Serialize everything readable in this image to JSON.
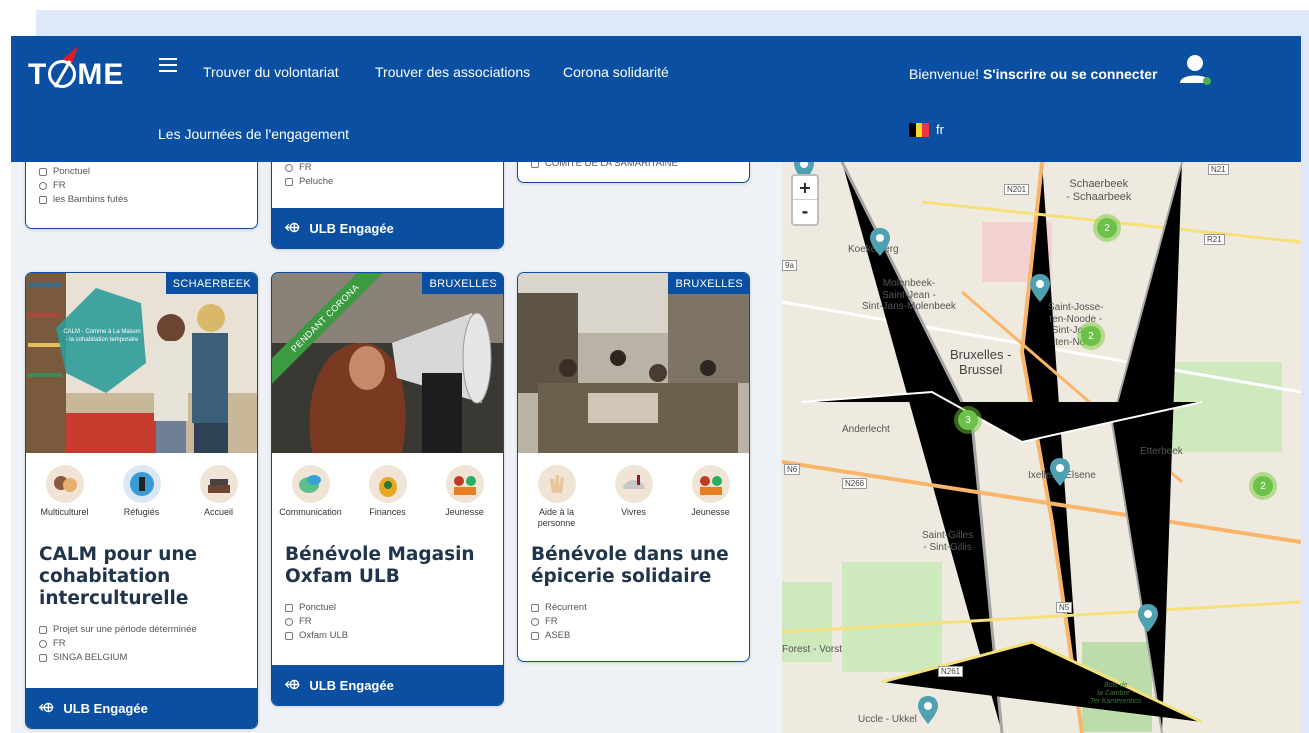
{
  "header": {
    "logo_text": "TIME",
    "nav": [
      "Trouver du volontariat",
      "Trouver des associations",
      "Corona solidarité"
    ],
    "nav_second_row": "Les Journées de l'engagement",
    "welcome": "Bienvenue!",
    "login": "S'inscrire ou se connecter",
    "lang": "fr"
  },
  "top_cards": [
    {
      "meta": [
        "Ponctuel",
        "FR",
        "les Bambins futés"
      ]
    },
    {
      "meta": [
        "FR",
        "Peluche"
      ],
      "footer": "ULB Engagée"
    },
    {
      "meta": [
        "COMITE DE LA SAMARITAINE"
      ]
    }
  ],
  "cards": [
    {
      "place": "SCHAERBEEK",
      "image_caption": "CALM - Comme à La Maison - la cohabitation temporaire",
      "tags": [
        "Multiculturel",
        "Réfugiés",
        "Accueil"
      ],
      "title": "CALM pour une cohabitation interculturelle",
      "meta": [
        "Projet sur une période déterminée",
        "FR",
        "SINGA BELGIUM"
      ],
      "footer": "ULB Engagée"
    },
    {
      "place": "BRUXELLES",
      "ribbon": "PENDANT CORONA",
      "tags": [
        "Communication",
        "Finances",
        "Jeunesse"
      ],
      "title": "Bénévole Magasin Oxfam ULB",
      "meta": [
        "Ponctuel",
        "FR",
        "Oxfam ULB"
      ],
      "footer": "ULB Engagée"
    },
    {
      "place": "BRUXELLES",
      "tags": [
        "Aide à la personne",
        "Vivres",
        "Jeunesse"
      ],
      "title": "Bénévole dans une épicerie solidaire",
      "meta": [
        "Récurrent",
        "FR",
        "ASEB"
      ]
    }
  ],
  "map": {
    "zoom_in": "+",
    "zoom_out": "-",
    "labels": {
      "schaerbeek": "Schaerbeek\n- Schaarbeek",
      "koekelberg": "Koekelberg",
      "molenbeek": "Molenbeek-\nSaint-Jean -\nSint-Jans-Molenbeek",
      "sjtn": "Saint-Josse-\nten-Noode -\nSint-Joost-\nten-Node",
      "bruxelles": "Bruxelles -\nBrussel",
      "anderlecht": "Anderlecht",
      "etterbeek": "Etterbeek",
      "ixelles": "Ixelles - Elsene",
      "saintgilles": "Saint-Gilles\n- Sint-Gillis",
      "forest": "Forest - Vorst",
      "uccle": "Uccle - Ukkel",
      "bois": "Bois de\nla Cambre -\nTer Kamerenbos"
    },
    "roads": [
      "N201",
      "N21",
      "R21",
      "N6",
      "N266",
      "N5",
      "N261",
      "9a"
    ],
    "clusters": [
      "2",
      "2",
      "3",
      "2"
    ]
  }
}
